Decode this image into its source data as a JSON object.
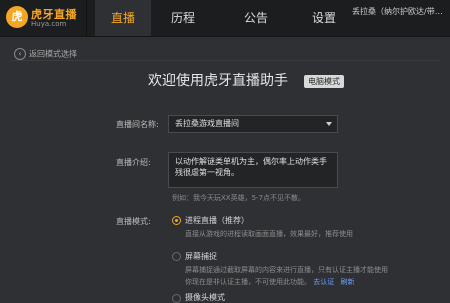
{
  "app": {
    "logo_text": "虎牙直播",
    "logo_sub": "Huya.com",
    "tabs": [
      {
        "label": "直播",
        "active": true
      },
      {
        "label": "历程",
        "active": false
      },
      {
        "label": "公告",
        "active": false
      },
      {
        "label": "设置",
        "active": false
      }
    ],
    "user_name": "丢拉桑（纳尔护欧达/带…"
  },
  "colors": {
    "accent": "#f5a623",
    "link": "#6fa0ff",
    "background": "#2f3033",
    "topbar": "#1c1d1f"
  },
  "page": {
    "back_label": "返回模式选择",
    "title": "欢迎使用虎牙直播助手",
    "mode_badge": "电脑模式"
  },
  "form": {
    "room_name_label": "直播间名称:",
    "room_name_value": "丢拉桑游戏直播间",
    "intro_label": "直播介绍:",
    "intro_value": "以动作解谜类单机为主，偶尔率上动作类手残很虐第一视角。",
    "intro_hint": "例如：我今天玩XX英雄，5-7点不见不散。",
    "mode_label": "直播模式:",
    "options": [
      {
        "title": "进程直播（推荐）",
        "desc": "直接从游戏的进程读取画面直播，效果最好，推荐使用",
        "selected": true
      },
      {
        "title": "屏幕捕捉",
        "desc": "屏幕捕捉通过截取屏幕的内容来进行直播，只有认证主播才能使用",
        "desc2_prefix": "你现在是非认证主播，不可使用此功能。",
        "link_auth": "去认证",
        "link_refresh": "刷新",
        "selected": false
      },
      {
        "title": "摄像头模式",
        "selected": false
      }
    ]
  }
}
